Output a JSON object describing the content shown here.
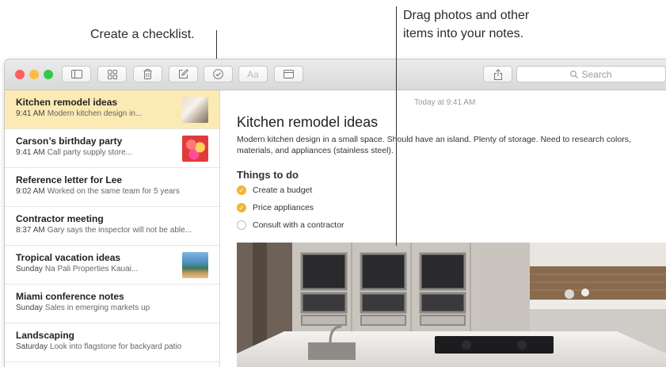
{
  "callouts": {
    "checklist": "Create a checklist.",
    "drag_line1": "Drag photos and other",
    "drag_line2": "items into your notes."
  },
  "toolbar": {
    "format_label": "Aa",
    "search_placeholder": "Search"
  },
  "notes": [
    {
      "title": "Kitchen remodel ideas",
      "time": "9:41 AM",
      "preview": "Modern kitchen design in...",
      "selected": true,
      "thumbnail": "kitchen"
    },
    {
      "title": "Carson’s birthday party",
      "time": "9:41 AM",
      "preview": "Call party supply store...",
      "thumbnail": "balloons"
    },
    {
      "title": "Reference letter for Lee",
      "time": "9:02 AM",
      "preview": "Worked on the same team for 5 years"
    },
    {
      "title": "Contractor meeting",
      "time": "8:37 AM",
      "preview": "Gary says the inspector will not be able..."
    },
    {
      "title": "Tropical vacation ideas",
      "time": "Sunday",
      "preview": "Na Pali Properties Kauai...",
      "thumbnail": "coast"
    },
    {
      "title": "Miami conference notes",
      "time": "Sunday",
      "preview": "Sales in emerging markets up"
    },
    {
      "title": "Landscaping",
      "time": "Saturday",
      "preview": "Look into flagstone for backyard patio"
    }
  ],
  "editor": {
    "date": "Today at 9:41 AM",
    "title": "Kitchen remodel ideas",
    "body": "Modern kitchen design in a small space. Should have an island. Plenty of storage. Need to research colors, materials, and appliances (stainless steel).",
    "section_title": "Things to do",
    "checklist": [
      {
        "text": "Create a budget",
        "done": true
      },
      {
        "text": "Price appliances",
        "done": true
      },
      {
        "text": "Consult with a contractor",
        "done": false
      }
    ]
  },
  "colors": {
    "selected_row": "#fbeab3",
    "check_done": "#f4b431",
    "close": "#fc605c",
    "minimize": "#fdbc40",
    "zoom": "#34c84a"
  }
}
